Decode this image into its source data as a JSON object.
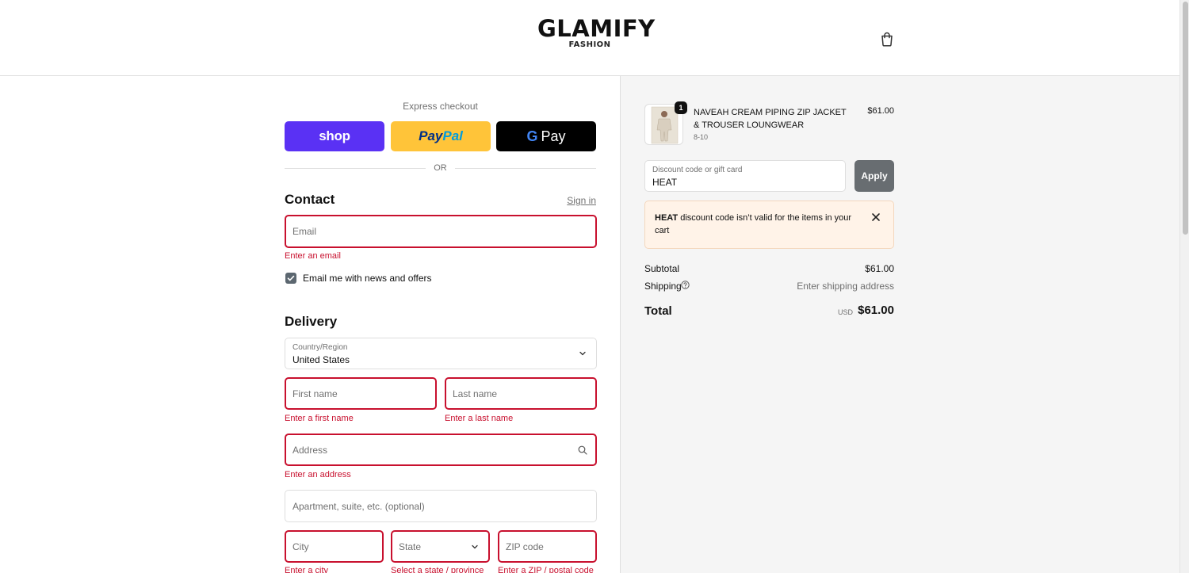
{
  "header": {
    "brand": "GLAMIFY",
    "brand_sub": "FASHION",
    "cart_icon": "shopping-bag-icon"
  },
  "express": {
    "label": "Express checkout",
    "shop_label": "shop",
    "paypal_part1": "Pay",
    "paypal_part2": "Pal",
    "gpay_g": "G",
    "gpay_label": "Pay",
    "or": "OR"
  },
  "contact": {
    "title": "Contact",
    "signin": "Sign in",
    "email_placeholder": "Email",
    "email_error": "Enter an email",
    "newsletter_label": "Email me with news and offers",
    "newsletter_checked": true
  },
  "delivery": {
    "title": "Delivery",
    "country_label": "Country/Region",
    "country_value": "United States",
    "first_name_placeholder": "First name",
    "first_name_error": "Enter a first name",
    "last_name_placeholder": "Last name",
    "last_name_error": "Enter a last name",
    "address_placeholder": "Address",
    "address_error": "Enter an address",
    "apartment_placeholder": "Apartment, suite, etc. (optional)",
    "city_placeholder": "City",
    "city_error": "Enter a city",
    "state_placeholder": "State",
    "state_error": "Select a state / province",
    "zip_placeholder": "ZIP code",
    "zip_error": "Enter a ZIP / postal code"
  },
  "order": {
    "product_name": "NAVEAH CREAM PIPING ZIP JACKET & TROUSER LOUNGWEAR",
    "product_variant": "8-10",
    "product_price": "$61.00",
    "quantity": "1",
    "discount_label": "Discount code or gift card",
    "discount_value": "HEAT",
    "apply_label": "Apply",
    "notice_code": "HEAT",
    "notice_text": " discount code isn’t valid for the items in your cart",
    "subtotal_label": "Subtotal",
    "subtotal_value": "$61.00",
    "shipping_label": "Shipping",
    "shipping_value": "Enter shipping address",
    "total_label": "Total",
    "total_currency": "USD",
    "total_value": "$61.00"
  },
  "colors": {
    "error": "#c8102e",
    "shop_pay": "#5a31f4",
    "paypal": "#ffc439",
    "gpay": "#000000",
    "apply_button": "#686d71",
    "notice_bg": "#fff3e8",
    "summary_bg": "#f5f5f5"
  }
}
